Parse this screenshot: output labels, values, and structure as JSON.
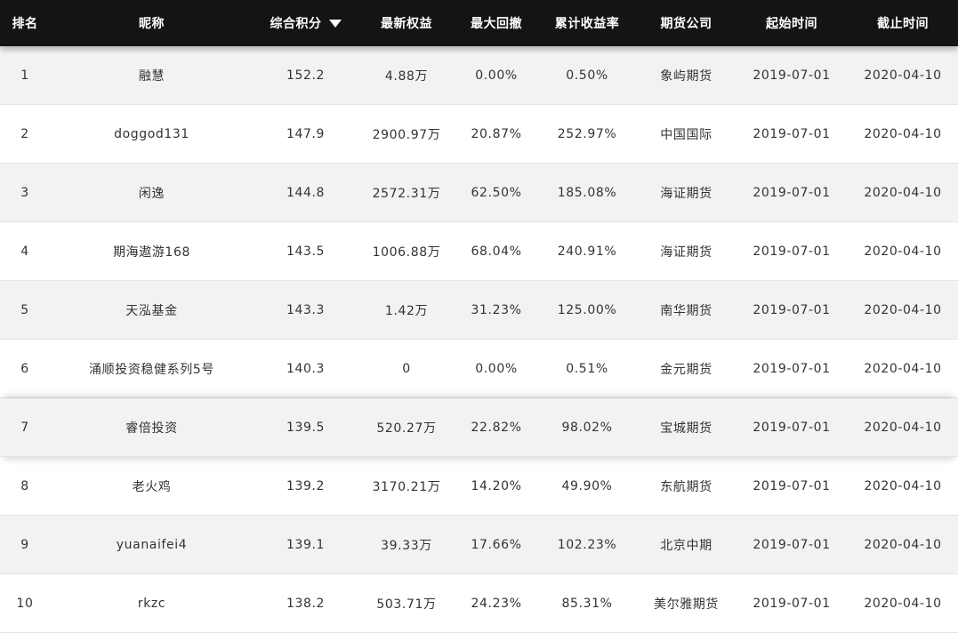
{
  "table": {
    "columns": {
      "rank": "排名",
      "nickname": "昵称",
      "score": "综合积分",
      "equity": "最新权益",
      "drawdown": "最大回撤",
      "return": "累计收益率",
      "company": "期货公司",
      "start": "起始时间",
      "end": "截止时间"
    },
    "sort_icon": "caret-down-icon",
    "rows": [
      {
        "rank": "1",
        "nickname": "融慧",
        "score": "152.2",
        "equity": "4.88万",
        "drawdown": "0.00%",
        "return": "0.50%",
        "company": "象屿期货",
        "start": "2019-07-01",
        "end": "2020-04-10"
      },
      {
        "rank": "2",
        "nickname": "doggod131",
        "score": "147.9",
        "equity": "2900.97万",
        "drawdown": "20.87%",
        "return": "252.97%",
        "company": "中国国际",
        "start": "2019-07-01",
        "end": "2020-04-10"
      },
      {
        "rank": "3",
        "nickname": "闲逸",
        "score": "144.8",
        "equity": "2572.31万",
        "drawdown": "62.50%",
        "return": "185.08%",
        "company": "海证期货",
        "start": "2019-07-01",
        "end": "2020-04-10"
      },
      {
        "rank": "4",
        "nickname": "期海遨游168",
        "score": "143.5",
        "equity": "1006.88万",
        "drawdown": "68.04%",
        "return": "240.91%",
        "company": "海证期货",
        "start": "2019-07-01",
        "end": "2020-04-10"
      },
      {
        "rank": "5",
        "nickname": "天泓基金",
        "score": "143.3",
        "equity": "1.42万",
        "drawdown": "31.23%",
        "return": "125.00%",
        "company": "南华期货",
        "start": "2019-07-01",
        "end": "2020-04-10"
      },
      {
        "rank": "6",
        "nickname": "涌顺投资稳健系列5号",
        "score": "140.3",
        "equity": "0",
        "drawdown": "0.00%",
        "return": "0.51%",
        "company": "金元期货",
        "start": "2019-07-01",
        "end": "2020-04-10"
      },
      {
        "rank": "7",
        "nickname": "睿倍投资",
        "score": "139.5",
        "equity": "520.27万",
        "drawdown": "22.82%",
        "return": "98.02%",
        "company": "宝城期货",
        "start": "2019-07-01",
        "end": "2020-04-10"
      },
      {
        "rank": "8",
        "nickname": "老火鸡",
        "score": "139.2",
        "equity": "3170.21万",
        "drawdown": "14.20%",
        "return": "49.90%",
        "company": "东航期货",
        "start": "2019-07-01",
        "end": "2020-04-10"
      },
      {
        "rank": "9",
        "nickname": "yuanaifei4",
        "score": "139.1",
        "equity": "39.33万",
        "drawdown": "17.66%",
        "return": "102.23%",
        "company": "北京中期",
        "start": "2019-07-01",
        "end": "2020-04-10"
      },
      {
        "rank": "10",
        "nickname": "rkzc",
        "score": "138.2",
        "equity": "503.71万",
        "drawdown": "24.23%",
        "return": "85.31%",
        "company": "美尔雅期货",
        "start": "2019-07-01",
        "end": "2020-04-10"
      }
    ]
  }
}
